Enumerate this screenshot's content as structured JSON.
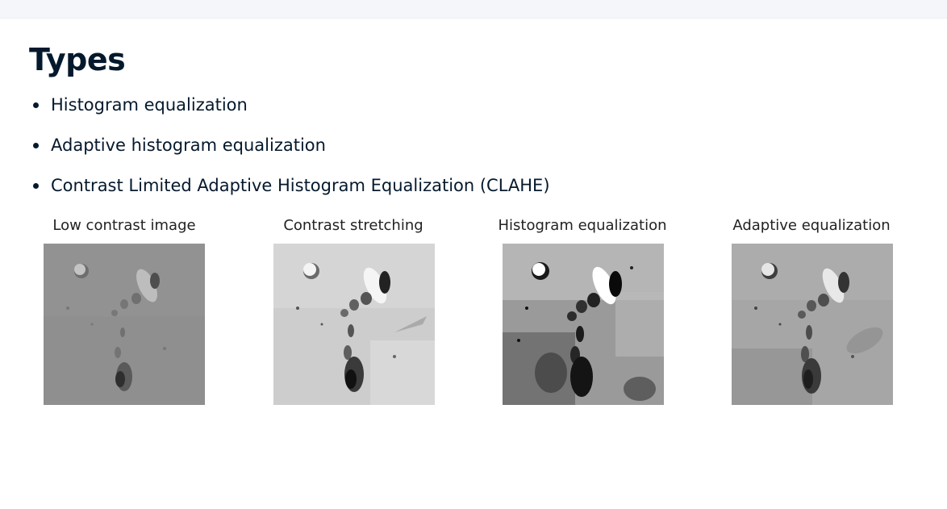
{
  "slide": {
    "title": "Types",
    "bullets": [
      "Histogram equalization",
      "Adaptive histogram equalization",
      "Contrast Limited Adaptive Histogram Equalization (CLAHE)"
    ]
  },
  "figure": {
    "panels": [
      {
        "caption": "Low contrast image"
      },
      {
        "caption": "Contrast stretching"
      },
      {
        "caption": "Histogram equalization"
      },
      {
        "caption": "Adaptive equalization"
      }
    ]
  }
}
